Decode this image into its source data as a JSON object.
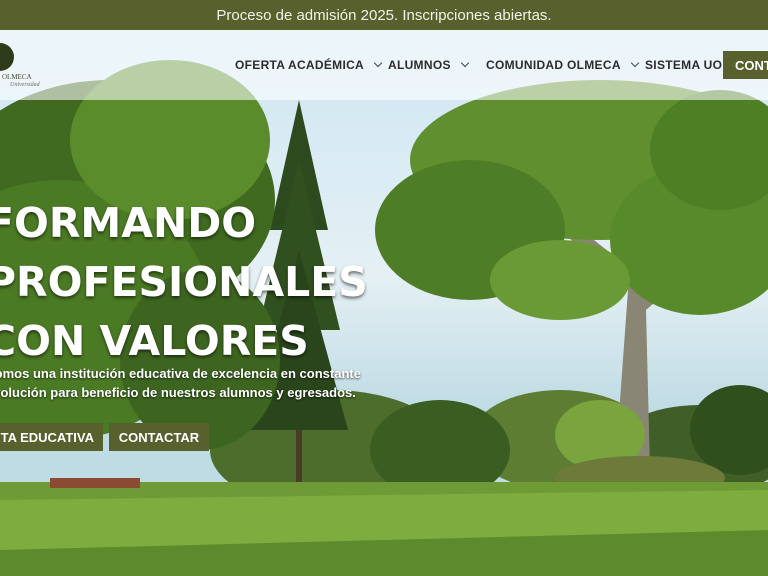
{
  "announcement": {
    "text": "Proceso de admisión 2025. Inscripciones abiertas."
  },
  "logo": {
    "line1": "OLMECA",
    "line2": "Universidad"
  },
  "nav": {
    "items": [
      {
        "label": "OFERTA ACADÉMICA",
        "has_dropdown": true
      },
      {
        "label": "ALUMNOS",
        "has_dropdown": true
      },
      {
        "label": "COMUNIDAD OLMECA",
        "has_dropdown": true
      },
      {
        "label": "SISTEMA UO",
        "has_dropdown": false
      }
    ],
    "contact_label": "CONTACTAR"
  },
  "hero": {
    "headline_lines": [
      "FORMANDO",
      "PROFESIONALES",
      "CON VALORES"
    ],
    "subtitle_lines": [
      "Somos una institución educativa de excelencia en constante",
      "evolución para beneficio de nuestros alumnos y egresados."
    ],
    "cta_primary": "OFERTA EDUCATIVA",
    "cta_secondary": "CONTACTAR"
  },
  "colors": {
    "brand": "#58602e",
    "topbar_text": "#f4f2e4",
    "hero_text": "#ffffff"
  }
}
